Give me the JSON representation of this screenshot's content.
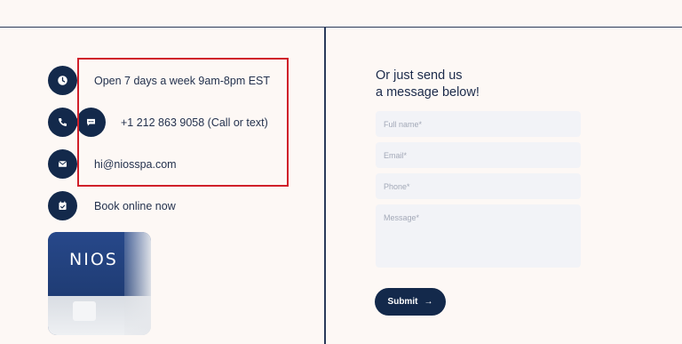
{
  "contact": {
    "hours": "Open 7 days a week 9am-8pm EST",
    "phone": "+1 212 863 9058 (Call or text)",
    "email": "hi@niosspa.com",
    "book": "Book online now"
  },
  "photo": {
    "logo_text": "NIOS"
  },
  "form": {
    "title_line1": "Or just send us",
    "title_line2": "a message below!",
    "name_placeholder": "Full name*",
    "email_placeholder": "Email*",
    "phone_placeholder": "Phone*",
    "message_placeholder": "Message*",
    "submit_label": "Submit",
    "submit_arrow": "→"
  },
  "colors": {
    "background": "#fdf8f5",
    "navy": "#13294b",
    "highlight": "#d0202a",
    "field_bg": "#f2f3f7"
  },
  "icons": [
    "clock-icon",
    "phone-icon",
    "chat-icon",
    "mail-icon",
    "calendar-icon"
  ]
}
